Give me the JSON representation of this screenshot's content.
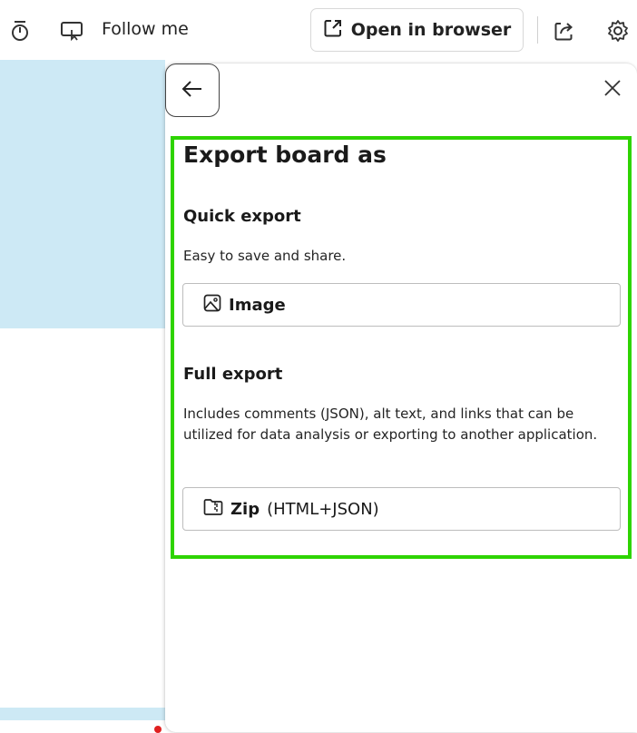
{
  "toolbar": {
    "follow_label": "Follow me",
    "open_browser_label": "Open in browser"
  },
  "panel": {
    "title": "Export board as",
    "quick": {
      "heading": "Quick export",
      "description": "Easy to save and share.",
      "button_label": "Image"
    },
    "full": {
      "heading": "Full export",
      "description": "Includes comments (JSON), alt text, and links that can be utilized for data analysis or exporting to another application.",
      "button_bold": "Zip",
      "button_rest": "(HTML+JSON)"
    }
  },
  "colors": {
    "highlight": "#2ed400",
    "canvas": "#cde9f5"
  },
  "icons": [
    "timer-icon",
    "follow-cast-icon",
    "open-external-icon",
    "share-icon",
    "gear-icon",
    "back-arrow-icon",
    "close-icon",
    "image-icon",
    "zip-folder-icon"
  ]
}
